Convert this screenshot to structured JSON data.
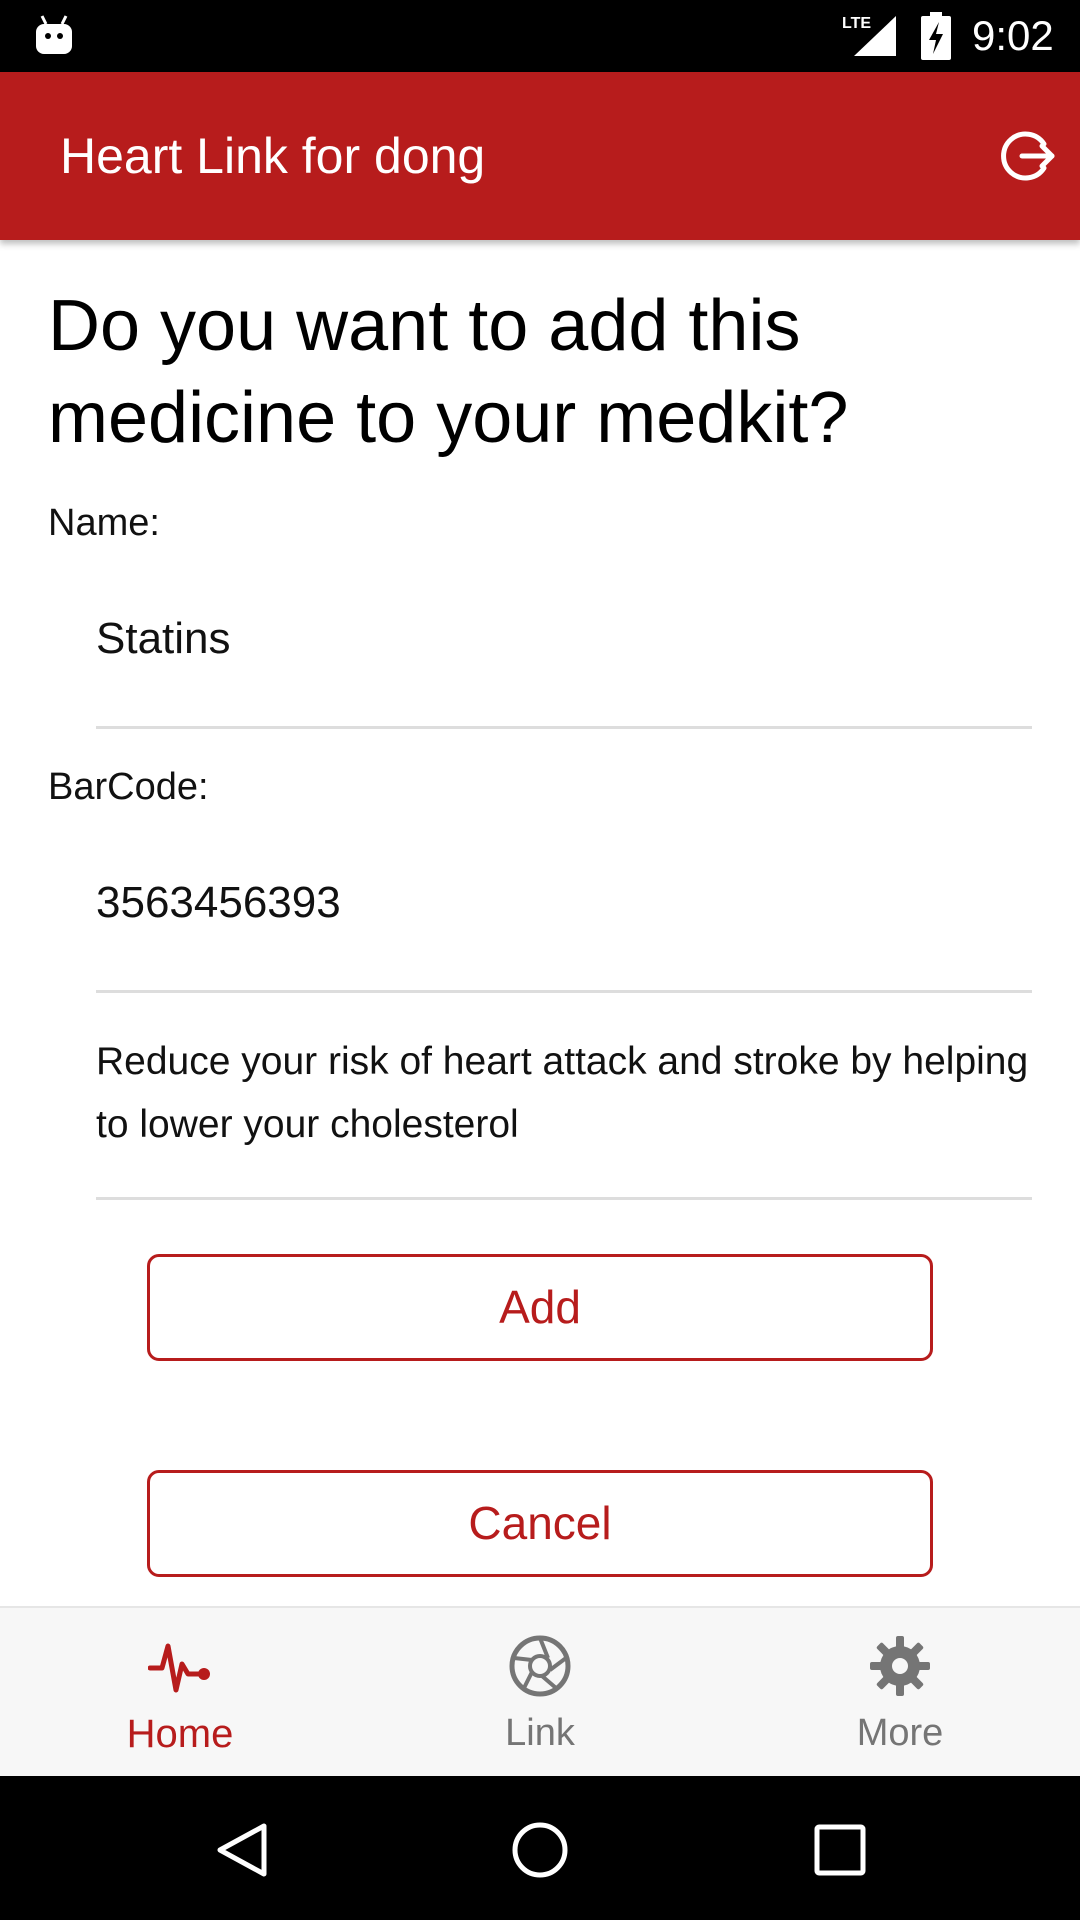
{
  "status_bar": {
    "network_label": "LTE",
    "time": "9:02",
    "icons": [
      "android-icon",
      "lte-signal-icon",
      "battery-charging-icon"
    ]
  },
  "app_bar": {
    "title": "Heart Link for dong",
    "action_icon": "logout-icon"
  },
  "form": {
    "heading": "Do you want to add this medicine to your medkit?",
    "name_label": "Name:",
    "name_value": "Statins",
    "barcode_label": "BarCode:",
    "barcode_value": "3563456393",
    "description": "Reduce your risk of heart attack and stroke by helping to lower your cholesterol",
    "add_label": "Add",
    "cancel_label": "Cancel"
  },
  "bottom_nav": {
    "items": [
      {
        "label": "Home",
        "icon": "heartbeat-icon",
        "active": true
      },
      {
        "label": "Link",
        "icon": "aperture-icon",
        "active": false
      },
      {
        "label": "More",
        "icon": "gear-icon",
        "active": false
      }
    ]
  },
  "system_nav": {
    "icons": [
      "back-icon",
      "home-circle-icon",
      "recents-icon"
    ]
  },
  "colors": {
    "accent": "#b71c1c",
    "inactive": "#757575",
    "divider": "#dddddd"
  }
}
